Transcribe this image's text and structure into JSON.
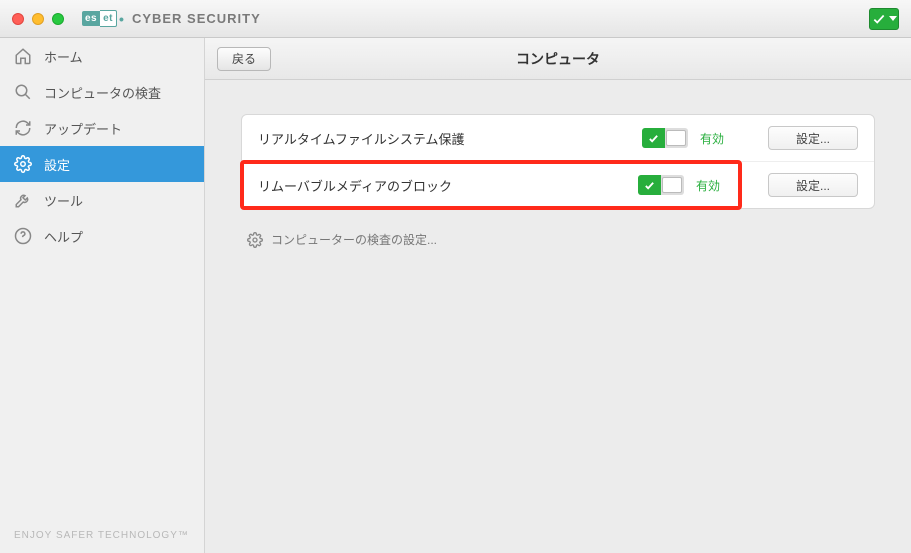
{
  "titlebar": {
    "brand": "CYBER SECURITY"
  },
  "sidebar": {
    "items": [
      {
        "label": "ホーム"
      },
      {
        "label": "コンピュータの検査"
      },
      {
        "label": "アップデート"
      },
      {
        "label": "設定"
      },
      {
        "label": "ツール"
      },
      {
        "label": "ヘルプ"
      }
    ],
    "footer": "ENJOY SAFER TECHNOLOGY™"
  },
  "header": {
    "back": "戻る",
    "title": "コンピュータ"
  },
  "rows": [
    {
      "label": "リアルタイムファイルシステム保護",
      "status": "有効",
      "button": "設定..."
    },
    {
      "label": "リムーバブルメディアのブロック",
      "status": "有効",
      "button": "設定..."
    }
  ],
  "link": "コンピューターの検査の設定..."
}
